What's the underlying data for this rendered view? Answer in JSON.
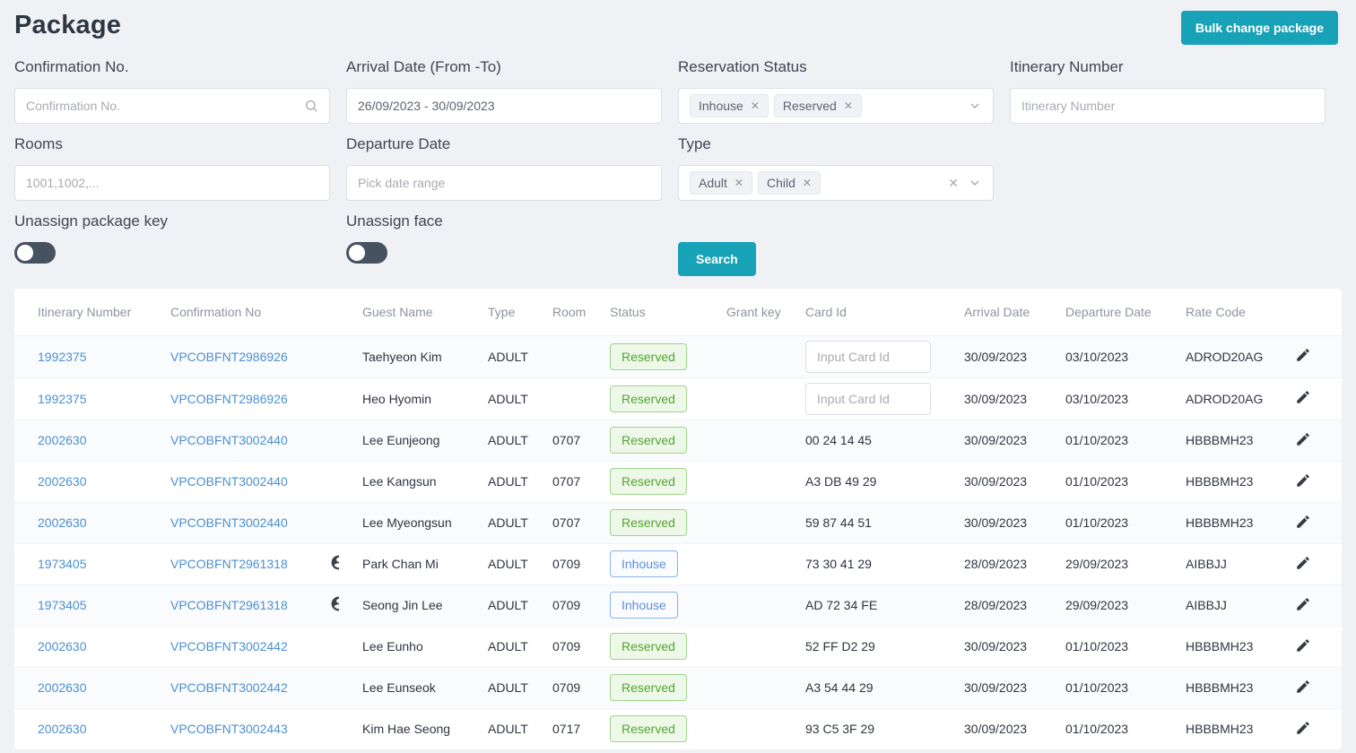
{
  "colors": {
    "accent_teal": "#18a2b8",
    "link_blue": "#4a90d2",
    "reserved_green": "#55a335",
    "inhouse_blue": "#5b8fd9"
  },
  "page": {
    "title": "Package",
    "bulk_button_label": "Bulk change package",
    "search_button_label": "Search"
  },
  "filters": {
    "confirmation": {
      "label": "Confirmation No.",
      "placeholder": "Confirmation No."
    },
    "arrival": {
      "label": "Arrival Date (From -To)",
      "value": "26/09/2023 - 30/09/2023"
    },
    "reservation_status": {
      "label": "Reservation Status",
      "tags": [
        "Inhouse",
        "Reserved"
      ]
    },
    "itinerary": {
      "label": "Itinerary Number",
      "placeholder": "Itinerary Number"
    },
    "rooms": {
      "label": "Rooms",
      "placeholder": "1001,1002,..."
    },
    "departure": {
      "label": "Departure Date",
      "placeholder": "Pick date range"
    },
    "type": {
      "label": "Type",
      "tags": [
        "Adult",
        "Child"
      ]
    },
    "unassign_package_key": {
      "label": "Unassign package key",
      "on": false
    },
    "unassign_face": {
      "label": "Unassign face",
      "on": false
    }
  },
  "table": {
    "columns": [
      "Itinerary Number",
      "Confirmation No",
      "",
      "Guest Name",
      "Type",
      "Room",
      "Status",
      "Grant key",
      "Card Id",
      "Arrival Date",
      "Departure Date",
      "Rate Code",
      ""
    ],
    "card_input_placeholder": "Input Card Id",
    "rows": [
      {
        "itinerary": "1992375",
        "confirmation": "VPCOBFNT2986926",
        "person": false,
        "guest": "Taehyeon Kim",
        "type": "ADULT",
        "room": "",
        "status": "Reserved",
        "card": "",
        "card_input": true,
        "arrival": "30/09/2023",
        "departure": "03/10/2023",
        "rate": "ADROD20AG"
      },
      {
        "itinerary": "1992375",
        "confirmation": "VPCOBFNT2986926",
        "person": false,
        "guest": "Heo Hyomin",
        "type": "ADULT",
        "room": "",
        "status": "Reserved",
        "card": "",
        "card_input": true,
        "arrival": "30/09/2023",
        "departure": "03/10/2023",
        "rate": "ADROD20AG"
      },
      {
        "itinerary": "2002630",
        "confirmation": "VPCOBFNT3002440",
        "person": false,
        "guest": "Lee Eunjeong",
        "type": "ADULT",
        "room": "0707",
        "status": "Reserved",
        "card": "00 24 14 45",
        "card_input": false,
        "arrival": "30/09/2023",
        "departure": "01/10/2023",
        "rate": "HBBBMH23"
      },
      {
        "itinerary": "2002630",
        "confirmation": "VPCOBFNT3002440",
        "person": false,
        "guest": "Lee Kangsun",
        "type": "ADULT",
        "room": "0707",
        "status": "Reserved",
        "card": "A3 DB 49 29",
        "card_input": false,
        "arrival": "30/09/2023",
        "departure": "01/10/2023",
        "rate": "HBBBMH23"
      },
      {
        "itinerary": "2002630",
        "confirmation": "VPCOBFNT3002440",
        "person": false,
        "guest": "Lee Myeongsun",
        "type": "ADULT",
        "room": "0707",
        "status": "Reserved",
        "card": "59 87 44 51",
        "card_input": false,
        "arrival": "30/09/2023",
        "departure": "01/10/2023",
        "rate": "HBBBMH23"
      },
      {
        "itinerary": "1973405",
        "confirmation": "VPCOBFNT2961318",
        "person": true,
        "guest": "Park Chan Mi",
        "type": "ADULT",
        "room": "0709",
        "status": "Inhouse",
        "card": "73 30 41 29",
        "card_input": false,
        "arrival": "28/09/2023",
        "departure": "29/09/2023",
        "rate": "AIBBJJ"
      },
      {
        "itinerary": "1973405",
        "confirmation": "VPCOBFNT2961318",
        "person": true,
        "guest": "Seong Jin Lee",
        "type": "ADULT",
        "room": "0709",
        "status": "Inhouse",
        "card": "AD 72 34 FE",
        "card_input": false,
        "arrival": "28/09/2023",
        "departure": "29/09/2023",
        "rate": "AIBBJJ"
      },
      {
        "itinerary": "2002630",
        "confirmation": "VPCOBFNT3002442",
        "person": false,
        "guest": "Lee Eunho",
        "type": "ADULT",
        "room": "0709",
        "status": "Reserved",
        "card": "52 FF D2 29",
        "card_input": false,
        "arrival": "30/09/2023",
        "departure": "01/10/2023",
        "rate": "HBBBMH23"
      },
      {
        "itinerary": "2002630",
        "confirmation": "VPCOBFNT3002442",
        "person": false,
        "guest": "Lee Eunseok",
        "type": "ADULT",
        "room": "0709",
        "status": "Reserved",
        "card": "A3 54 44 29",
        "card_input": false,
        "arrival": "30/09/2023",
        "departure": "01/10/2023",
        "rate": "HBBBMH23"
      },
      {
        "itinerary": "2002630",
        "confirmation": "VPCOBFNT3002443",
        "person": false,
        "guest": "Kim Hae Seong",
        "type": "ADULT",
        "room": "0717",
        "status": "Reserved",
        "card": "93 C5 3F 29",
        "card_input": false,
        "arrival": "30/09/2023",
        "departure": "01/10/2023",
        "rate": "HBBBMH23"
      }
    ]
  }
}
